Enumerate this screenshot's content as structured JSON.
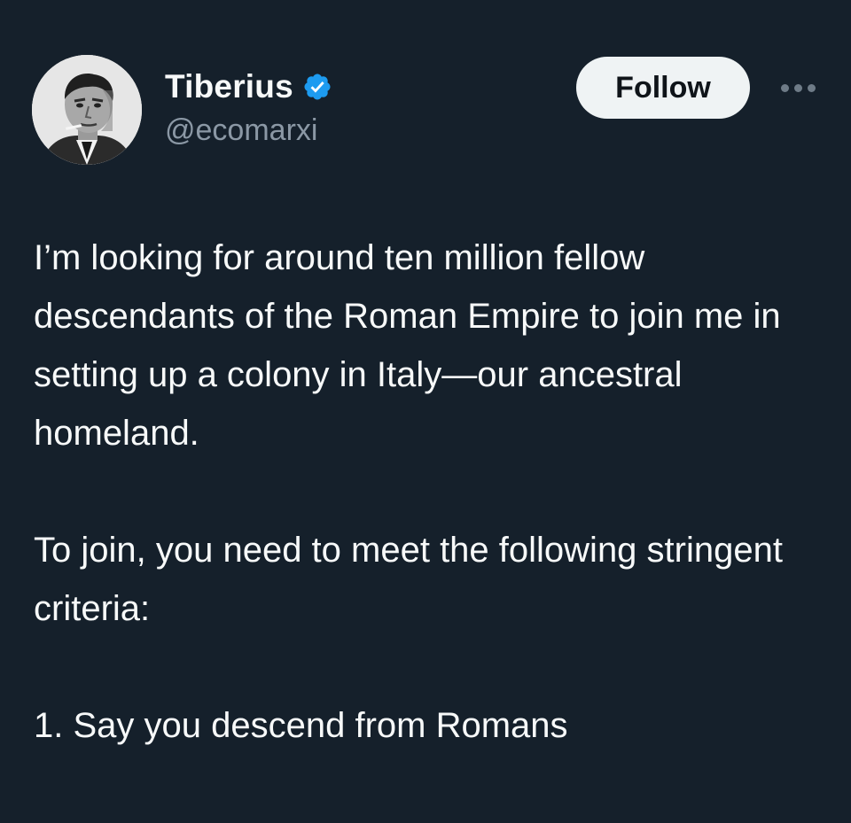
{
  "author": {
    "display_name": "Tiberius",
    "handle": "@ecomarxi",
    "verified": true,
    "verified_color": "#1d9bf0",
    "avatar_icon": "black-and-white-portrait"
  },
  "actions": {
    "follow_label": "Follow",
    "more_icon": "more-horizontal-icon"
  },
  "tweet": {
    "paragraphs": [
      "I’m looking for around ten million fellow descendants of the Roman Empire to join me in setting up a colony in Italy—our ancestral homeland.",
      "To join, you need to meet the following stringent criteria:",
      "1. Say you descend from Romans"
    ]
  },
  "colors": {
    "background": "#15202b",
    "text": "#f7f9f9",
    "secondary_text": "#8b98a5",
    "follow_bg": "#eff3f4",
    "follow_text": "#0f1419"
  }
}
